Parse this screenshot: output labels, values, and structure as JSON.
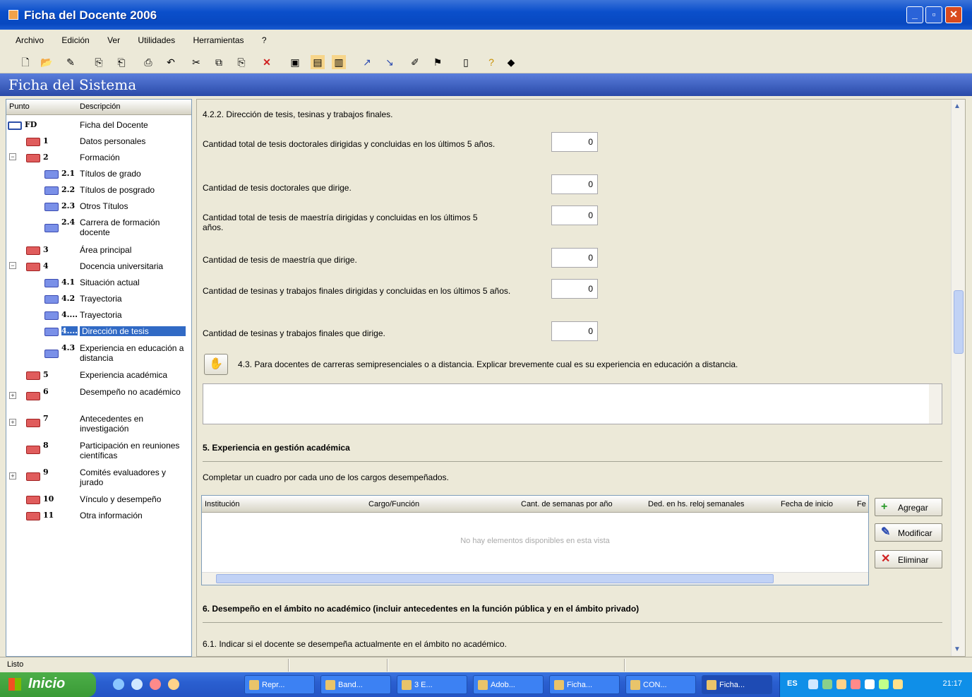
{
  "window": {
    "title": "Ficha del Docente 2006",
    "minimize": "_",
    "maximize": "▫",
    "close": "✕"
  },
  "menu": {
    "items": [
      "Archivo",
      "Edición",
      "Ver",
      "Utilidades",
      "Herramientas",
      "?"
    ]
  },
  "system_header": "Ficha del Sistema",
  "tree": {
    "col_punto": "Punto",
    "col_desc": "Descripción",
    "items": [
      {
        "code": "FD",
        "desc": "Ficha del Docente"
      },
      {
        "code": "1",
        "desc": "Datos personales"
      },
      {
        "code": "2",
        "desc": "Formación"
      },
      {
        "code": "2.1",
        "desc": "Títulos de grado"
      },
      {
        "code": "2.2",
        "desc": "Títulos de posgrado"
      },
      {
        "code": "2.3",
        "desc": "Otros Títulos"
      },
      {
        "code": "2.4",
        "desc": "Carrera de formación docente"
      },
      {
        "code": "3",
        "desc": "Área principal"
      },
      {
        "code": "4",
        "desc": "Docencia universitaria"
      },
      {
        "code": "4.1",
        "desc": "Situación actual"
      },
      {
        "code": "4.2",
        "desc": "Trayectoria"
      },
      {
        "code": "4....",
        "desc": "Trayectoria"
      },
      {
        "code": "4....",
        "desc": "Dirección de tesis"
      },
      {
        "code": "4.3",
        "desc": "Experiencia en educación a distancia"
      },
      {
        "code": "5",
        "desc": "Experiencia académica"
      },
      {
        "code": "6",
        "desc": "Desempeño no académico"
      },
      {
        "code": "7",
        "desc": "Antecedentes en investigación"
      },
      {
        "code": "8",
        "desc": "Participación en reuniones científicas"
      },
      {
        "code": "9",
        "desc": "Comités evaluadores y jurado"
      },
      {
        "code": "10",
        "desc": "Vínculo y desempeño"
      },
      {
        "code": "11",
        "desc": "Otra información"
      }
    ]
  },
  "main": {
    "section_422": "4.2.2. Dirección de tesis, tesinas y trabajos finales.",
    "fields": [
      {
        "label": "Cantidad total de tesis doctorales dirigidas y concluidas en los últimos 5 años.",
        "value": "0"
      },
      {
        "label": "Cantidad de tesis doctorales que dirige.",
        "value": "0"
      },
      {
        "label": "Cantidad total de tesis de maestría dirigidas y concluidas en los últimos 5 años.",
        "value": "0"
      },
      {
        "label": "Cantidad de tesis de maestría que dirige.",
        "value": "0"
      },
      {
        "label": "Cantidad de tesinas y trabajos finales dirigidas y concluidas en los últimos 5 años.",
        "value": "0"
      },
      {
        "label": "Cantidad de tesinas y trabajos finales que dirige.",
        "value": "0"
      }
    ],
    "section_43": "4.3. Para docentes de carreras semipresenciales o a distancia. Explicar brevemente cual es su experiencia en educación a distancia.",
    "section_5_title": "5. Experiencia en gestión académica",
    "section_5_desc": "Completar un cuadro por cada uno de los cargos desempeñados.",
    "grid": {
      "columns": [
        "Institución",
        "Cargo/Función",
        "Cant. de semanas por año",
        "Ded. en hs. reloj semanales",
        "Fecha de inicio",
        "Fe"
      ],
      "empty": "No hay elementos disponibles en esta vista"
    },
    "buttons": {
      "add": "Agregar",
      "edit": "Modificar",
      "delete": "Eliminar"
    },
    "section_6_title": "6. Desempeño en el ámbito no académico (incluir antecedentes en la función pública y en el ámbito privado)",
    "section_61": "6.1. Indicar si el docente se desempeña actualmente en el ámbito no académico."
  },
  "status": {
    "text": "Listo"
  },
  "taskbar": {
    "start": "Inicio",
    "tasks": [
      "Repr...",
      "Band...",
      "3 E...",
      "Adob...",
      "Ficha...",
      "CON...",
      "Ficha..."
    ],
    "lang": "ES",
    "clock": "21:17"
  }
}
